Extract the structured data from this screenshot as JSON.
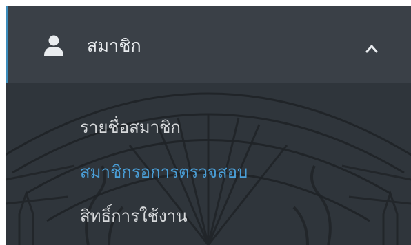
{
  "menu": {
    "label": "สมาชิก",
    "icon": "user-icon",
    "expanded_icon": "chevron-up-icon",
    "items": [
      {
        "label": "รายชื่อสมาชิก",
        "active": false
      },
      {
        "label": "สมาชิกรอการตรวจสอบ",
        "active": true
      },
      {
        "label": "สิทธิ์การใช้งาน",
        "active": false
      }
    ]
  },
  "colors": {
    "sidebar_bg": "#343a40",
    "submenu_bg": "#2f353b",
    "accent": "#3c8dbc",
    "active_text": "#4a9fd8",
    "text": "#d6d8da"
  }
}
